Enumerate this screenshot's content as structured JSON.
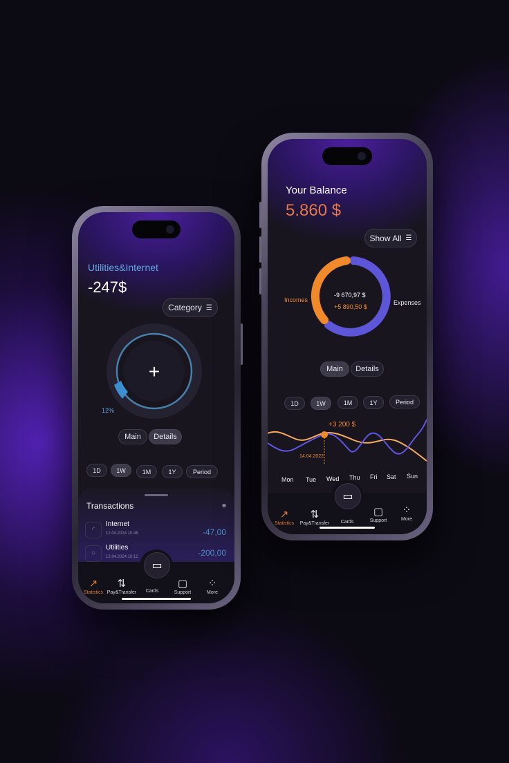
{
  "left_phone": {
    "title": "Utilities&Internet",
    "amount": "-247$",
    "filter_button": "Category",
    "ring_percent_label": "12%",
    "ring_percent_value": 12,
    "view_tabs": [
      "Main",
      "Details"
    ],
    "active_view_tab": "Details",
    "periods": [
      "1D",
      "1W",
      "1M",
      "1Y",
      "Period"
    ],
    "active_period": "1W",
    "transactions_title": "Transactions",
    "transactions": [
      {
        "name": "Internet",
        "date": "12.04.2024 10:46",
        "amount": "-47,00"
      },
      {
        "name": "Utilities",
        "date": "12.04.2024 10:12",
        "amount": "-200,00"
      }
    ]
  },
  "right_phone": {
    "title": "Your Balance",
    "balance": "5.860 $",
    "filter_button": "Show All",
    "donut": {
      "left_label": "Incomes",
      "right_label": "Expenses",
      "expense_value": "-9 670,97 $",
      "income_value": "+5 890,50 $"
    },
    "view_tabs": [
      "Main",
      "Details"
    ],
    "active_view_tab": "Main",
    "periods": [
      "1D",
      "1W",
      "1M",
      "1Y",
      "Period"
    ],
    "active_period": "1W",
    "line_chart": {
      "tooltip_value": "+3 200 $",
      "tooltip_date": "14.04.2022",
      "days": [
        "Mon",
        "Tue",
        "Wed",
        "Thu",
        "Fri",
        "Sat",
        "Sun"
      ],
      "highlight_day": "Wed"
    }
  },
  "nav": {
    "items": [
      {
        "label": "Statistics",
        "icon": "chart-icon",
        "active": true
      },
      {
        "label": "Pay&Transfer",
        "icon": "transfer-icon",
        "active": false
      },
      {
        "label": "Cards",
        "icon": "wallet-icon",
        "active": false
      },
      {
        "label": "Support",
        "icon": "chat-icon",
        "active": false
      },
      {
        "label": "More",
        "icon": "grid-icon",
        "active": false
      }
    ]
  },
  "colors": {
    "accent_orange": "#f08a2a",
    "accent_purple": "#6a5ce6",
    "accent_blue": "#4a9fd8",
    "background": "#0c0a13"
  }
}
